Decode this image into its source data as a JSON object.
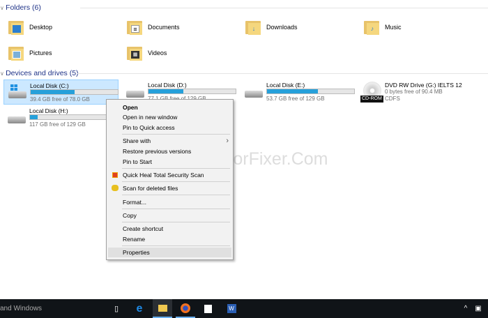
{
  "folders_header": "Folders (6)",
  "folders": [
    {
      "name": "Desktop",
      "icon": "desktop-folder-icon"
    },
    {
      "name": "Documents",
      "icon": "documents-folder-icon"
    },
    {
      "name": "Downloads",
      "icon": "downloads-folder-icon"
    },
    {
      "name": "Music",
      "icon": "music-folder-icon"
    },
    {
      "name": "Pictures",
      "icon": "pictures-folder-icon"
    },
    {
      "name": "Videos",
      "icon": "videos-folder-icon"
    }
  ],
  "drives_header": "Devices and drives (5)",
  "drives": [
    {
      "name": "Local Disk (C:)",
      "free": "39.4 GB free of 78.0 GB",
      "used_pct": 50
    },
    {
      "name": "Local Disk (D:)",
      "free": "77.1 GB free of 129 GB",
      "used_pct": 40
    },
    {
      "name": "Local Disk (E:)",
      "free": "53.7 GB free of 129 GB",
      "used_pct": 58
    },
    {
      "name": "DVD RW Drive (G:) IELTS 12",
      "free": "0 bytes free of 90.4 MB",
      "fs": "CDFS",
      "badge": "CD-ROM"
    },
    {
      "name": "Local Disk (H:)",
      "free": "117 GB free of 129 GB",
      "used_pct": 9
    }
  ],
  "context_menu": [
    "Open",
    "Open in new window",
    "Pin to Quick access",
    "Share with",
    "Restore previous versions",
    "Pin to Start",
    "Quick Heal Total Security Scan",
    "Scan for deleted files",
    "Format...",
    "Copy",
    "Create shortcut",
    "Rename",
    "Properties"
  ],
  "watermark": "WinErrorFixer.Com",
  "taskbar": {
    "search_text": "and Windows"
  },
  "colors": {
    "accent": "#26a0da",
    "selection": "#cce8ff",
    "taskbar": "#101418"
  }
}
